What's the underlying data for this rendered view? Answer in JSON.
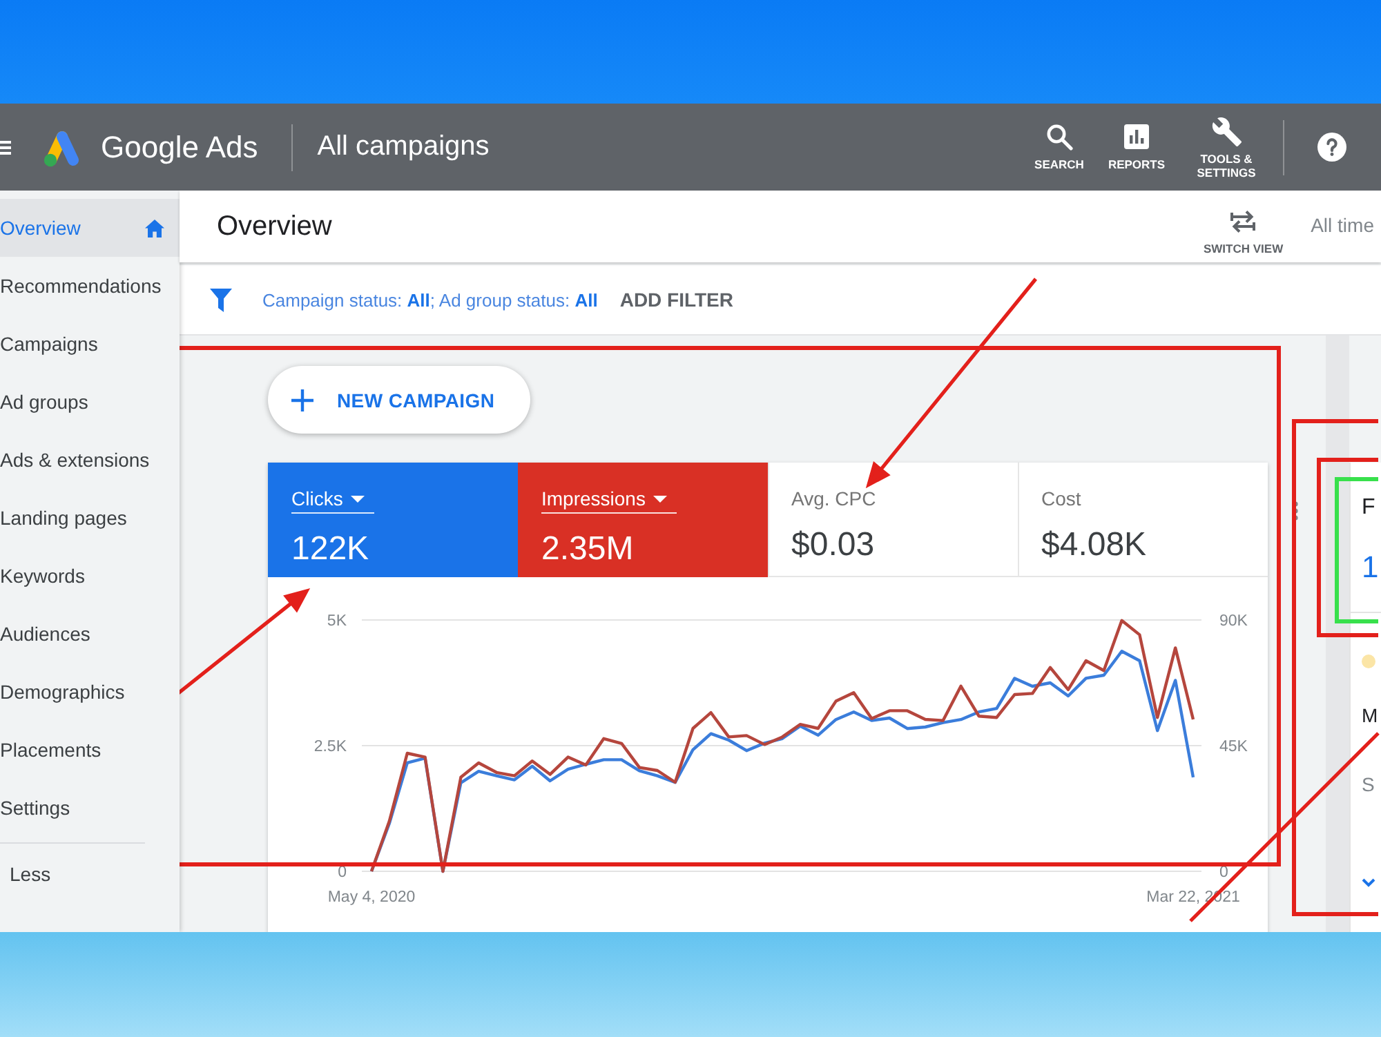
{
  "top_bar": {
    "product": "Google Ads",
    "title": "All campaigns",
    "actions": [
      {
        "kind": "search",
        "label": "SEARCH"
      },
      {
        "kind": "reports",
        "label": "REPORTS"
      },
      {
        "kind": "tools",
        "label": "TOOLS & SETTINGS"
      }
    ]
  },
  "sidebar": {
    "items": [
      {
        "label": "Overview",
        "selected": true
      },
      {
        "label": "Recommendations",
        "selected": false
      },
      {
        "label": "Campaigns",
        "selected": false
      },
      {
        "label": "Ad groups",
        "selected": false
      },
      {
        "label": "Ads & extensions",
        "selected": false
      },
      {
        "label": "Landing pages",
        "selected": false
      },
      {
        "label": "Keywords",
        "selected": false
      },
      {
        "label": "Audiences",
        "selected": false
      },
      {
        "label": "Demographics",
        "selected": false
      },
      {
        "label": "Placements",
        "selected": false
      },
      {
        "label": "Settings",
        "selected": false
      }
    ],
    "toggle": "Less"
  },
  "page_header": {
    "title": "Overview",
    "switch_view": "SWITCH VIEW",
    "date_range": "All time"
  },
  "filter_bar": {
    "filters": "Campaign status: **All**; Ad group status: **All**",
    "add_filter": "ADD FILTER"
  },
  "new_campaign_button": "NEW CAMPAIGN",
  "metrics": [
    {
      "label": "Clicks",
      "value": "122K",
      "selected": true,
      "color": "#1a73e8"
    },
    {
      "label": "Impressions",
      "value": "2.35M",
      "selected": true,
      "color": "#d93025"
    },
    {
      "label": "Avg. CPC",
      "value": "$0.03",
      "selected": false
    },
    {
      "label": "Cost",
      "value": "$4.08K",
      "selected": false
    }
  ],
  "chart": {
    "chart_data": {
      "type": "line",
      "categories": [
        "May 4, 2020",
        null,
        null,
        null,
        null,
        null,
        null,
        null,
        null,
        null,
        null,
        null,
        null,
        null,
        null,
        null,
        null,
        null,
        null,
        null,
        null,
        null,
        null,
        null,
        null,
        null,
        null,
        null,
        null,
        null,
        null,
        null,
        null,
        null,
        null,
        null,
        null,
        null,
        null,
        null,
        null,
        null,
        null,
        null,
        null,
        null,
        "Mar 22, 2021"
      ],
      "ylim": [
        0,
        5000
      ],
      "yticks": [
        {
          "value": 0,
          "label": "0"
        },
        {
          "value": 2500,
          "label": "2.5K"
        },
        {
          "value": 5000,
          "label": "5K"
        }
      ],
      "y2lim": [
        0,
        90000
      ],
      "y2ticks": [
        {
          "value": 0,
          "label": "0"
        },
        {
          "value": 45000,
          "label": "45K"
        },
        {
          "value": 90000,
          "label": "90K"
        }
      ],
      "series": [
        {
          "color": "#3b7ddb",
          "values": [
            0,
            950,
            2160,
            2250,
            0,
            1760,
            1990,
            1900,
            1820,
            2090,
            1800,
            2030,
            2130,
            2220,
            2220,
            2000,
            1900,
            1770,
            2420,
            2740,
            2610,
            2400,
            2550,
            2640,
            2890,
            2710,
            3020,
            3170,
            3000,
            3050,
            2840,
            2870,
            2960,
            3020,
            3170,
            3240,
            3840,
            3680,
            3750,
            3490,
            3840,
            3900,
            4380,
            4190,
            2800,
            3800,
            1870
          ]
        },
        {
          "color": "#b5463d",
          "axis": "y2",
          "values": [
            0,
            17900,
            42300,
            40900,
            0,
            33700,
            38800,
            35400,
            34200,
            39500,
            34700,
            40900,
            38100,
            47500,
            45800,
            37200,
            36100,
            31900,
            51200,
            56800,
            48100,
            48600,
            45400,
            48100,
            52600,
            51200,
            60900,
            64000,
            54700,
            57500,
            57500,
            54400,
            54000,
            66300,
            55600,
            55100,
            63300,
            63700,
            73000,
            65100,
            75400,
            71900,
            89800,
            84700,
            55100,
            80000,
            54400
          ]
        }
      ]
    }
  },
  "side_card": {
    "texts": [
      {
        "kind": "title",
        "text": "F"
      },
      {
        "kind": "value",
        "text": "1"
      },
      {
        "kind": "body",
        "text": "M"
      },
      {
        "kind": "muted",
        "text": "S"
      }
    ]
  },
  "annotations": [
    {
      "kind": "box",
      "color": "#e3201b"
    },
    {
      "kind": "box",
      "color": "#e3201b"
    },
    {
      "kind": "box",
      "color": "#e3201b"
    },
    {
      "kind": "box",
      "color": "#38e04c"
    },
    {
      "kind": "arrow",
      "color": "#e3201b"
    },
    {
      "kind": "arrow",
      "color": "#e3201b"
    },
    {
      "kind": "line",
      "color": "#e3201b"
    }
  ]
}
